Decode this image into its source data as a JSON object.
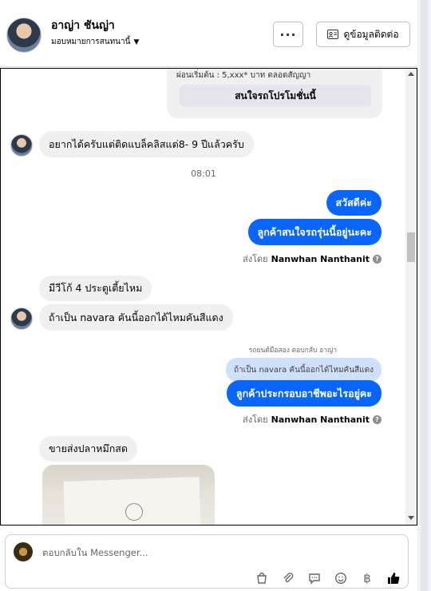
{
  "header": {
    "name": "อาญ่า ชันญ่า",
    "subtitle": "มอบหมายการสนทนานี้",
    "more_label": "···",
    "contact_label": "ดูข้อมูลติดต่อ"
  },
  "thread": {
    "card": {
      "text": "ผ่อนเริ่มต้น : 5,xxx* บาท ตลอดสัญญา",
      "button": "สนใจรถโปรโมชั่นนี้"
    },
    "messages": {
      "in1": "อยากได้ครับแต่ติดแบล็คลิสแต่8- 9 ปีแล้วครับ",
      "time": "08:01",
      "out1": "สวัสดีค่ะ",
      "out2": "ลูกค้าสนใจรถรุ่นนี้อยู่นะคะ",
      "sentby_prefix": "ส่งโดย",
      "sentby_name": "Nanwhan Nanthanit",
      "in2": "มีวีโก้ 4 ประตูเตี้ยไหม",
      "in3": "ถ้าเป็น navara คันนี้ออกได้ไหมคันสีแดง",
      "reply_meta": "รถยนต์มือสอง ตอบกลับ อาญ่า",
      "reply_quote": "ถ้าเป็น navara คันนี้ออกได้ไหมคันสีแดง",
      "out3": "ลูกค้าประกรอบอาชีพอะไรอยู่คะ",
      "in4": "ขายส่งปลาหมึกสด"
    }
  },
  "composer": {
    "placeholder": "ตอบกลับใน Messenger..."
  },
  "icons": [
    "caret-down-icon",
    "contact-card-icon",
    "bag-icon",
    "attach-icon",
    "chat-icon",
    "emoji-icon",
    "baht-icon",
    "like-icon",
    "help-icon"
  ],
  "colors": {
    "accent": "#0866ff",
    "bubble_in": "#f0f0f0",
    "reply_quote": "#cfe0fb"
  }
}
